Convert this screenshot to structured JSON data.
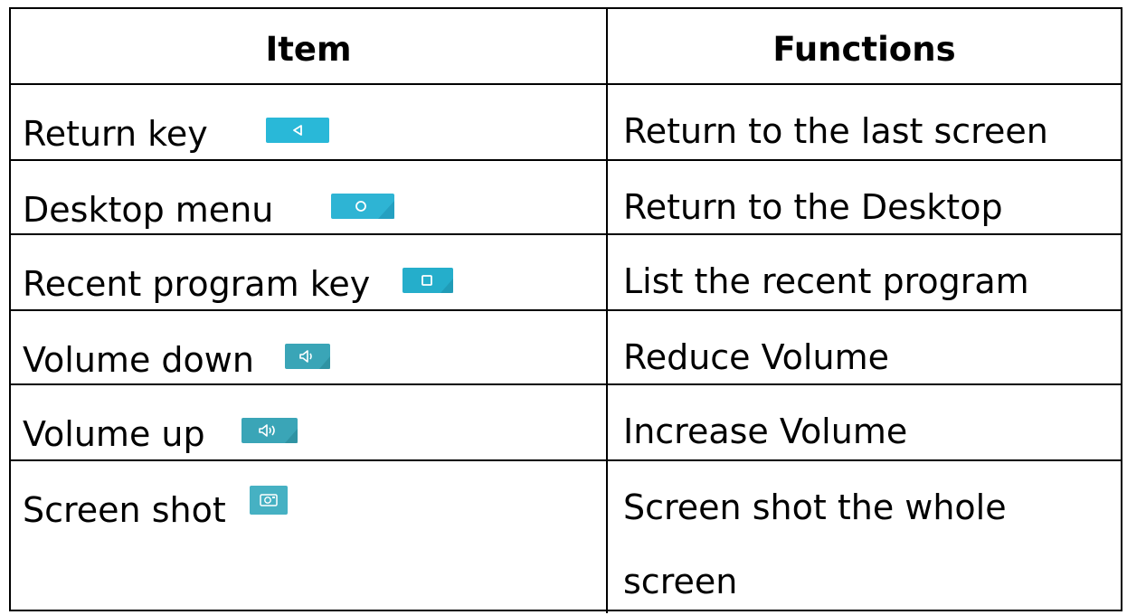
{
  "header": {
    "item": "Item",
    "functions": "Functions"
  },
  "rows": [
    {
      "item": "Return key",
      "icon": "back-triangle-icon",
      "icon_color": "#29b8d8",
      "function": "Return to the last screen"
    },
    {
      "item": "Desktop menu",
      "icon": "home-circle-icon",
      "icon_color": "#2eb4d4",
      "function": "Return to the Desktop"
    },
    {
      "item": "Recent program key",
      "icon": "recent-square-icon",
      "icon_color": "#25aecb",
      "function": "List the recent program"
    },
    {
      "item": "Volume down",
      "icon": "volume-down-icon",
      "icon_color": "#3aa5b7",
      "function": "Reduce Volume"
    },
    {
      "item": "Volume up",
      "icon": "volume-up-icon",
      "icon_color": "#3aa5b7",
      "function": "Increase Volume"
    },
    {
      "item": "Screen shot",
      "icon": "screenshot-camera-icon",
      "icon_color": "#46b1c3",
      "function_line1": "Screen shot the whole",
      "function_line2": "screen"
    }
  ]
}
